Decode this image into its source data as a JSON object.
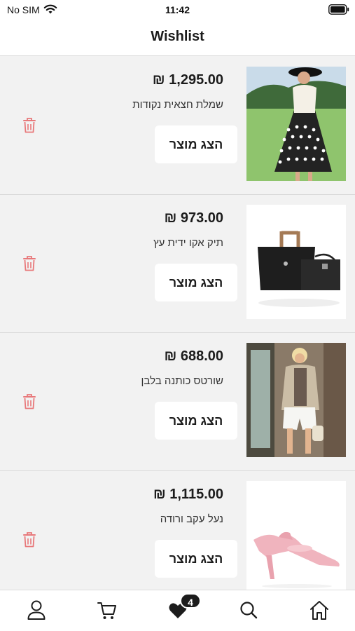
{
  "status_bar": {
    "carrier": "No SIM",
    "time": "11:42"
  },
  "header": {
    "title": "Wishlist"
  },
  "wishlist": {
    "view_label": "הצג מוצר",
    "items": [
      {
        "price": "₪ 1,295.00",
        "name": "שמלת חצאית נקודות",
        "image": "dress-photo"
      },
      {
        "price": "₪ 973.00",
        "name": "תיק אקו ידית עץ",
        "image": "bag-photo"
      },
      {
        "price": "₪ 688.00",
        "name": "שורטס כותנה בלבן",
        "image": "shorts-photo"
      },
      {
        "price": "₪ 1,115.00",
        "name": "נעל עקב ורודה",
        "image": "pink-heel-photo"
      }
    ]
  },
  "tabbar": {
    "items": [
      "profile-icon",
      "cart-icon",
      "wishlist-heart-icon",
      "search-icon",
      "home-icon"
    ],
    "wishlist_count": "4"
  },
  "colors": {
    "trash": "#e8787a",
    "text": "#1c1c1c",
    "background": "#f2f2f2"
  }
}
